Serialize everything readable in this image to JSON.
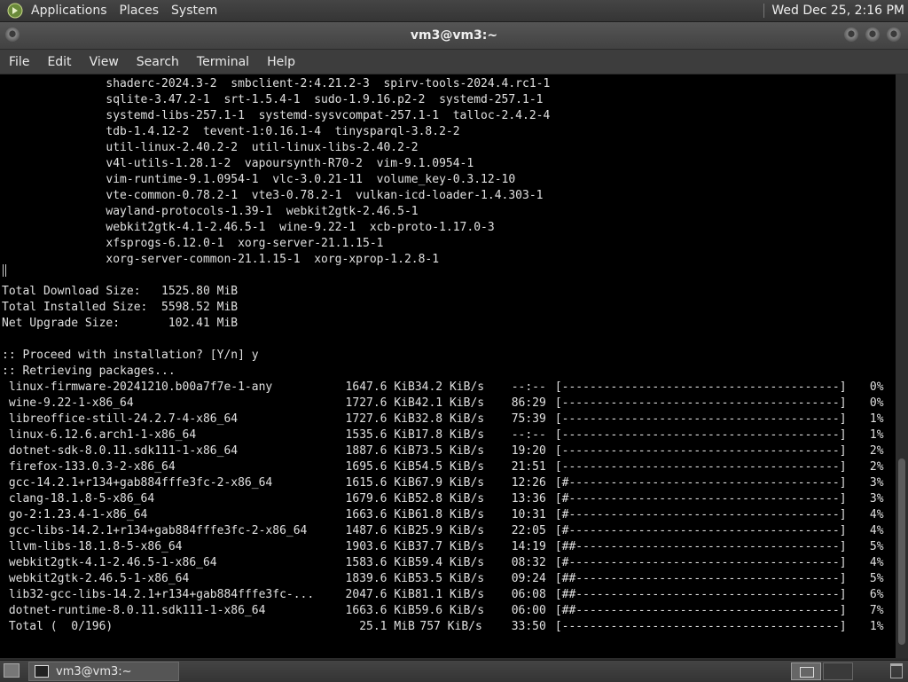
{
  "top_panel": {
    "menus": [
      "Applications",
      "Places",
      "System"
    ],
    "clock": "Wed Dec 25,  2:16 PM"
  },
  "window": {
    "title": "vm3@vm3:~"
  },
  "menubar": [
    "File",
    "Edit",
    "View",
    "Search",
    "Terminal",
    "Help"
  ],
  "terminal": {
    "package_lines": [
      "               shaderc-2024.3-2  smbclient-2:4.21.2-3  spirv-tools-2024.4.rc1-1",
      "               sqlite-3.47.2-1  srt-1.5.4-1  sudo-1.9.16.p2-2  systemd-257.1-1",
      "               systemd-libs-257.1-1  systemd-sysvcompat-257.1-1  talloc-2.4.2-4",
      "               tdb-1.4.12-2  tevent-1:0.16.1-4  tinysparql-3.8.2-2",
      "               util-linux-2.40.2-2  util-linux-libs-2.40.2-2",
      "               v4l-utils-1.28.1-2  vapoursynth-R70-2  vim-9.1.0954-1",
      "               vim-runtime-9.1.0954-1  vlc-3.0.21-11  volume_key-0.3.12-10",
      "               vte-common-0.78.2-1  vte3-0.78.2-1  vulkan-icd-loader-1.4.303-1",
      "               wayland-protocols-1.39-1  webkit2gtk-2.46.5-1",
      "               webkit2gtk-4.1-2.46.5-1  wine-9.22-1  xcb-proto-1.17.0-3",
      "               xfsprogs-6.12.0-1  xorg-server-21.1.15-1",
      "               xorg-server-common-21.1.15-1  xorg-xprop-1.2.8-1"
    ],
    "summary": [
      "Total Download Size:   1525.80 MiB",
      "Total Installed Size:  5598.52 MiB",
      "Net Upgrade Size:       102.41 MiB"
    ],
    "prompt": ":: Proceed with installation? [Y/n] y",
    "retrieving": ":: Retrieving packages...",
    "downloads": [
      {
        "name": "linux-firmware-20241210.b00a7f7e-1-any",
        "size": "1647.6 KiB",
        "rate": "34.2 KiB/s",
        "eta": "--:--",
        "bar": "[----------------------------------------]",
        "pct": "0%"
      },
      {
        "name": "wine-9.22-1-x86_64",
        "size": "1727.6 KiB",
        "rate": "42.1 KiB/s",
        "eta": "86:29",
        "bar": "[----------------------------------------]",
        "pct": "0%"
      },
      {
        "name": "libreoffice-still-24.2.7-4-x86_64",
        "size": "1727.6 KiB",
        "rate": "32.8 KiB/s",
        "eta": "75:39",
        "bar": "[----------------------------------------]",
        "pct": "1%"
      },
      {
        "name": "linux-6.12.6.arch1-1-x86_64",
        "size": "1535.6 KiB",
        "rate": "17.8 KiB/s",
        "eta": "--:--",
        "bar": "[----------------------------------------]",
        "pct": "1%"
      },
      {
        "name": "dotnet-sdk-8.0.11.sdk111-1-x86_64",
        "size": "1887.6 KiB",
        "rate": "73.5 KiB/s",
        "eta": "19:20",
        "bar": "[----------------------------------------]",
        "pct": "2%"
      },
      {
        "name": "firefox-133.0.3-2-x86_64",
        "size": "1695.6 KiB",
        "rate": "54.5 KiB/s",
        "eta": "21:51",
        "bar": "[----------------------------------------]",
        "pct": "2%"
      },
      {
        "name": "gcc-14.2.1+r134+gab884fffe3fc-2-x86_64",
        "size": "1615.6 KiB",
        "rate": "67.9 KiB/s",
        "eta": "12:26",
        "bar": "[#---------------------------------------]",
        "pct": "3%"
      },
      {
        "name": "clang-18.1.8-5-x86_64",
        "size": "1679.6 KiB",
        "rate": "52.8 KiB/s",
        "eta": "13:36",
        "bar": "[#---------------------------------------]",
        "pct": "3%"
      },
      {
        "name": "go-2:1.23.4-1-x86_64",
        "size": "1663.6 KiB",
        "rate": "61.8 KiB/s",
        "eta": "10:31",
        "bar": "[#---------------------------------------]",
        "pct": "4%"
      },
      {
        "name": "gcc-libs-14.2.1+r134+gab884fffe3fc-2-x86_64",
        "size": "1487.6 KiB",
        "rate": "25.9 KiB/s",
        "eta": "22:05",
        "bar": "[#---------------------------------------]",
        "pct": "4%"
      },
      {
        "name": "llvm-libs-18.1.8-5-x86_64",
        "size": "1903.6 KiB",
        "rate": "37.7 KiB/s",
        "eta": "14:19",
        "bar": "[##--------------------------------------]",
        "pct": "5%"
      },
      {
        "name": "webkit2gtk-4.1-2.46.5-1-x86_64",
        "size": "1583.6 KiB",
        "rate": "59.4 KiB/s",
        "eta": "08:32",
        "bar": "[#---------------------------------------]",
        "pct": "4%"
      },
      {
        "name": "webkit2gtk-2.46.5-1-x86_64",
        "size": "1839.6 KiB",
        "rate": "53.5 KiB/s",
        "eta": "09:24",
        "bar": "[##--------------------------------------]",
        "pct": "5%"
      },
      {
        "name": "lib32-gcc-libs-14.2.1+r134+gab884fffe3fc-...",
        "size": "2047.6 KiB",
        "rate": "81.1 KiB/s",
        "eta": "06:08",
        "bar": "[##--------------------------------------]",
        "pct": "6%"
      },
      {
        "name": "dotnet-runtime-8.0.11.sdk111-1-x86_64",
        "size": "1663.6 KiB",
        "rate": "59.6 KiB/s",
        "eta": "06:00",
        "bar": "[##--------------------------------------]",
        "pct": "7%"
      },
      {
        "name": "Total (  0/196)",
        "size": "25.1 MiB",
        "rate": "757 KiB/s",
        "eta": "33:50",
        "bar": "[----------------------------------------]",
        "pct": "1%"
      }
    ]
  },
  "taskbar": {
    "task_label": "vm3@vm3:~"
  }
}
